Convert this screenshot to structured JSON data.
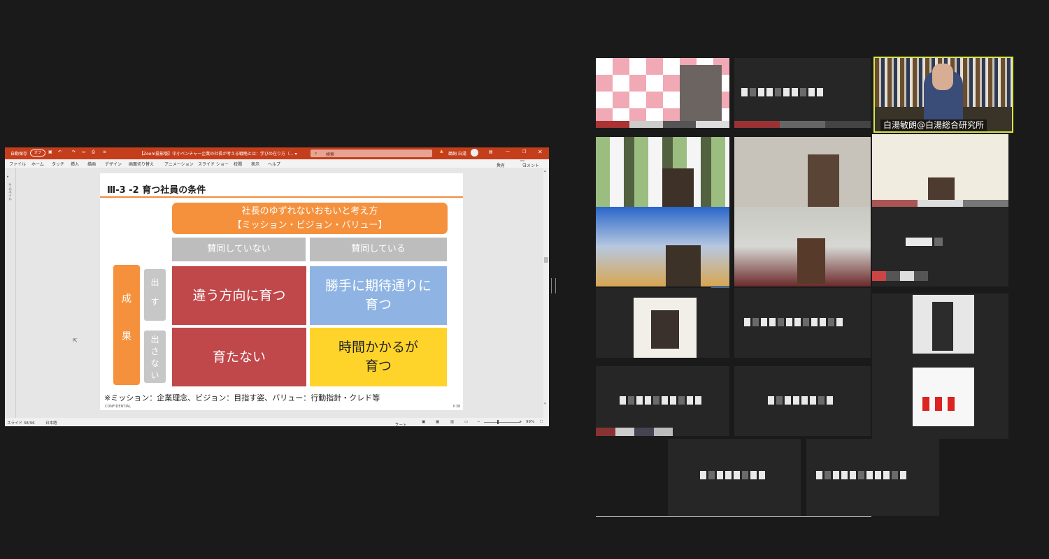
{
  "ppt": {
    "autosave": "自動保存",
    "toggle": "オフ",
    "doc_title": "【Zoom投影版】中小ベンチャー企業の社長が考える戦略とは：学びの在り方（... ▾",
    "search_placeholder": "検索",
    "user": "鵜飼 白湯",
    "tabs": [
      "ファイル",
      "ホーム",
      "タッチ",
      "挿入",
      "描画",
      "デザイン",
      "画面切り替え",
      "アニメーション",
      "スライド ショー",
      "校閲",
      "表示",
      "ヘルプ"
    ],
    "share": "共有",
    "comment": "コメント",
    "left_panel": "サムネイル",
    "status_slide": "スライド 38/96",
    "status_lang": "日本語",
    "status_notes": "ノート",
    "zoom": "99%"
  },
  "slide": {
    "title": "Ⅲ-3 -2  育つ社員の条件",
    "header_line1": "社長のゆずれないおもいと考え方",
    "header_line2": "【ミッション・ビジョン・バリュー】",
    "col1": "賛同していない",
    "col2": "賛同している",
    "result": "成\n\n\n果",
    "row1": "出\n\nす",
    "row2": "出\nさ\nな\nい",
    "cell11": "違う方向に育つ",
    "cell12": "勝手に期待通りに\n育つ",
    "cell21": "育たない",
    "cell22": "時間かかるが\n育つ",
    "footnote": "※ミッション：企業理念、ビジョン：目指す姿、バリュー：行動指針・クレド等",
    "confidential": "CONFIDENTIAL",
    "page": "P.38"
  },
  "zoom": {
    "speaker_name": "白湯敏朗@白湯総合研究所"
  },
  "colors": {
    "ppt_brand": "#c43e1c",
    "orange": "#f5913d",
    "red_cell": "#c0474a",
    "blue_cell": "#8fb4e3",
    "yellow_cell": "#ffd42a",
    "speaker_border": "#d7e64a"
  }
}
